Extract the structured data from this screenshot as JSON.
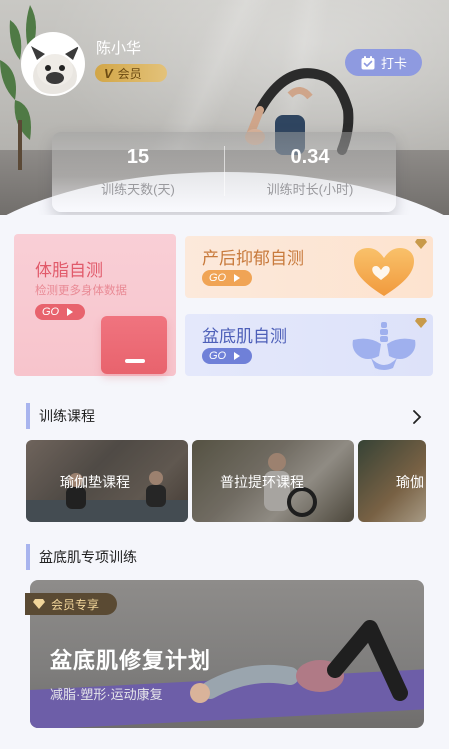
{
  "header": {
    "user_name": "陈小华",
    "member_badge": {
      "prefix": "V",
      "label": "会员"
    },
    "checkin_label": "打卡"
  },
  "stats": [
    {
      "value": "15",
      "label": "训练天数(天)"
    },
    {
      "value": "0.34",
      "label": "训练时长(小时)"
    }
  ],
  "self_tests": {
    "body_fat": {
      "title": "体脂自测",
      "subtitle": "检测更多身体数据",
      "go": "GO"
    },
    "postpartum_depression": {
      "title": "产后抑郁自测",
      "go": "GO"
    },
    "pelvic_floor": {
      "title": "盆底肌自测",
      "go": "GO"
    }
  },
  "courses_section": {
    "title": "训练课程",
    "items": [
      {
        "label": "瑜伽垫课程"
      },
      {
        "label": "普拉提环课程"
      },
      {
        "label": "瑜伽"
      }
    ]
  },
  "pelvic_section": {
    "title": "盆底肌专项训练",
    "plan": {
      "tag": "会员专享",
      "title": "盆底肌修复计划",
      "subtitle": "减脂·塑形·运动康复"
    }
  },
  "colors": {
    "accent": "#a8b4ee",
    "checkin_button": "#8e9ae0",
    "member_gold": "#d2a647",
    "body_fat_go": "#e8636d",
    "ppd_go": "#f0a455",
    "pelvic_go": "#6f80d8"
  }
}
